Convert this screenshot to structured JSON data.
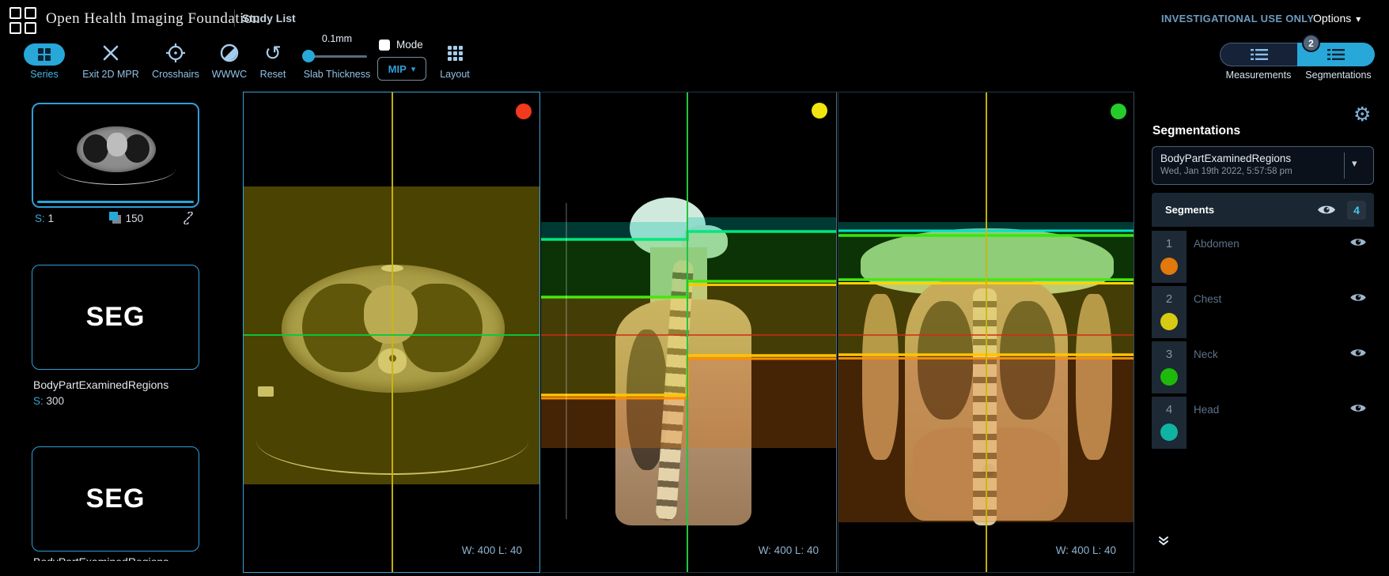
{
  "header": {
    "app_title": "Open Health Imaging Foundation",
    "nav_item": "Study List",
    "investigational": "INVESTIGATIONAL USE ONLY",
    "options_label": "Options"
  },
  "toolbar": {
    "series_label": "Series",
    "exit_mpr_label": "Exit 2D MPR",
    "crosshairs_label": "Crosshairs",
    "wwwc_label": "WWWC",
    "reset_label": "Reset",
    "slab_thickness_label": "Slab Thickness",
    "slab_thickness_value": "0.1mm",
    "mode_label": "Mode",
    "mip_label": "MIP",
    "layout_label": "Layout",
    "measurements_label": "Measurements",
    "segmentations_label": "Segmentations",
    "segmentations_badge": "2"
  },
  "study_panel": {
    "series_thumbnail": {
      "series_prefix": "S:",
      "series_number": "1",
      "instance_count": "150"
    },
    "seg_thumbnails": [
      {
        "type_label": "SEG",
        "description": "BodyPartExaminedRegions",
        "series_prefix": "S:",
        "series_number": "300"
      },
      {
        "type_label": "SEG",
        "description": "BodyPartExaminedRegions"
      }
    ]
  },
  "viewports": [
    {
      "orientation_dot_color": "#f23a1c",
      "window_level": "W: 400 L: 40"
    },
    {
      "orientation_dot_color": "#f2e40e",
      "window_level": "W: 400 L: 40"
    },
    {
      "orientation_dot_color": "#25cc2a",
      "window_level": "W: 400 L: 40"
    }
  ],
  "segmentation_panel": {
    "title": "Segmentations",
    "dropdown": {
      "label": "BodyPartExaminedRegions",
      "date": "Wed, Jan 19th 2022, 5:57:58 pm"
    },
    "segments_header_label": "Segments",
    "segments_count": "4",
    "segments": [
      {
        "index": "1",
        "label": "Abdomen",
        "color": "#e1790b"
      },
      {
        "index": "2",
        "label": "Chest",
        "color": "#d8ca12"
      },
      {
        "index": "3",
        "label": "Neck",
        "color": "#1eb90a"
      },
      {
        "index": "4",
        "label": "Head",
        "color": "#0fb3a2"
      }
    ]
  }
}
